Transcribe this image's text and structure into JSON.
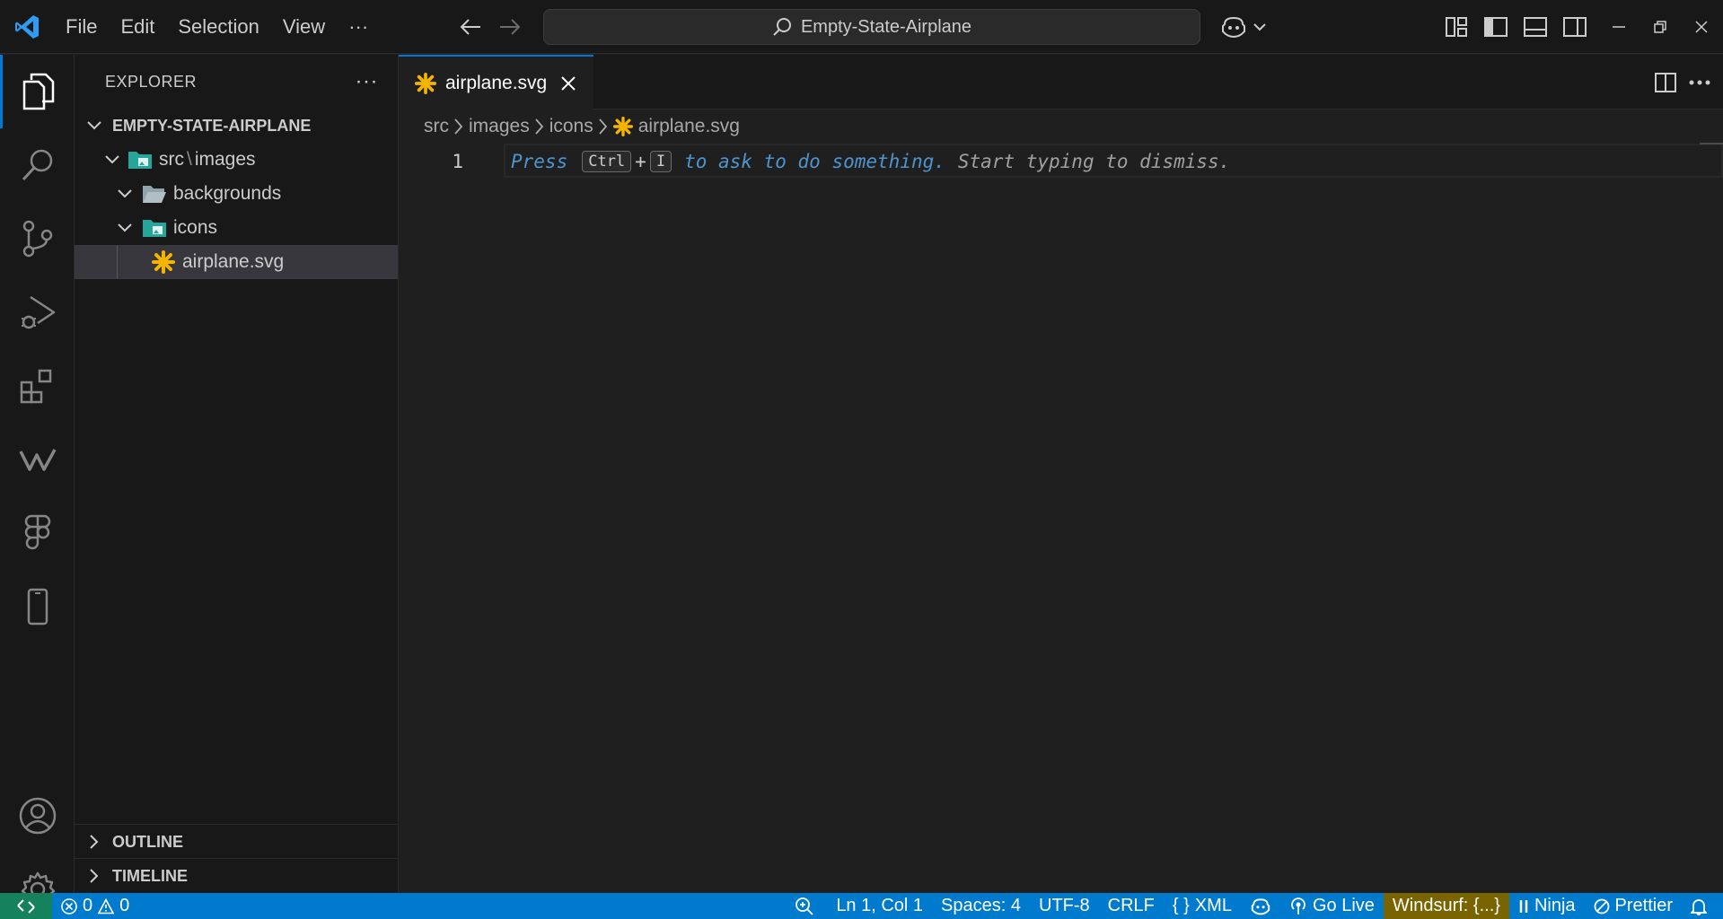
{
  "titlebar": {
    "menu": [
      "File",
      "Edit",
      "Selection",
      "View",
      "···"
    ],
    "search_text": "Empty-State-Airplane"
  },
  "sidebar": {
    "title": "EXPLORER",
    "more": "···",
    "root": "EMPTY-STATE-AIRPLANE",
    "tree": [
      {
        "label": "src",
        "sep": "\\",
        "label2": "images"
      },
      {
        "label": "backgrounds"
      },
      {
        "label": "icons"
      },
      {
        "label": "airplane.svg"
      }
    ],
    "outline": "OUTLINE",
    "timeline": "TIMELINE"
  },
  "editor": {
    "tab_label": "airplane.svg",
    "breadcrumb": [
      "src",
      "images",
      "icons",
      "airplane.svg"
    ],
    "line_number": "1",
    "hint": {
      "press": "Press",
      "key1": "Ctrl",
      "plus": "+",
      "key2": "I",
      "ask": "to ask to do something.",
      "dismiss": "Start typing to dismiss."
    }
  },
  "statusbar": {
    "errors": "0",
    "warnings": "0",
    "position": "Ln 1, Col 1",
    "spaces": "Spaces: 4",
    "encoding": "UTF-8",
    "eol": "CRLF",
    "language_braces": "{ }",
    "language": "XML",
    "go_live": "Go Live",
    "windsurf": "Windsurf: {...}",
    "ninja": "Ninja",
    "prettier": "Prettier"
  },
  "colors": {
    "accent": "#0078d4",
    "statusbar": "#007acc",
    "remote": "#16825d",
    "svg_icon": "#f5b400",
    "folder": "#90a4ae",
    "folder_teal": "#26a69a"
  }
}
